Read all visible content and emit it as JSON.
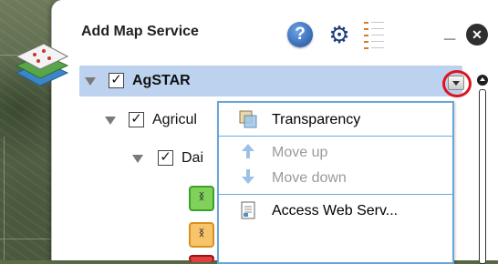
{
  "panel": {
    "title": "Add Map Service",
    "help_glyph": "?",
    "close_glyph": "✕",
    "minimize_glyph": "_"
  },
  "tree": [
    {
      "label": "AgSTAR",
      "checked": true,
      "level": 0
    },
    {
      "label": "Agricul",
      "checked": true,
      "level": 1
    },
    {
      "label": "Dai",
      "checked": true,
      "level": 2
    }
  ],
  "legend_swatches": [
    {
      "color": "#7fd15a",
      "border": "#3e9f2a"
    },
    {
      "color": "#f7c46a",
      "border": "#d89020"
    },
    {
      "color": "#e04040",
      "border": "#a01010"
    }
  ],
  "context_menu": {
    "items": [
      {
        "label": "Transparency",
        "enabled": true,
        "icon": "transparency-icon"
      },
      {
        "label": "Move up",
        "enabled": false,
        "icon": "arrow-up-icon"
      },
      {
        "label": "Move down",
        "enabled": false,
        "icon": "arrow-down-icon"
      },
      {
        "label": "Access Web Serv...",
        "enabled": true,
        "icon": "document-icon"
      }
    ]
  },
  "colors": {
    "selected_row": "#bcd2ee",
    "menu_border": "#69a6d8",
    "highlight_circle": "#e0141e"
  }
}
